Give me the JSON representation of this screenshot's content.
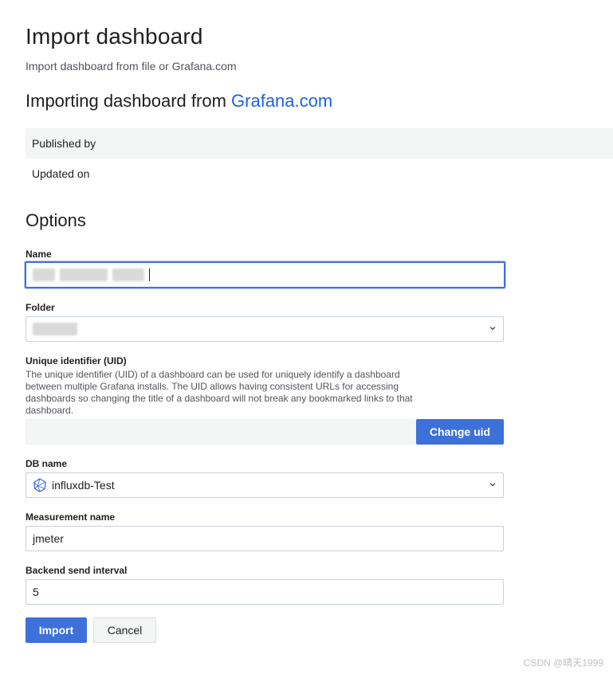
{
  "header": {
    "title": "Import dashboard",
    "subtitle": "Import dashboard from file or Grafana.com"
  },
  "importing": {
    "prefix": "Importing dashboard from ",
    "link": "Grafana.com"
  },
  "info": {
    "published_by": "Published by",
    "updated_on": "Updated on"
  },
  "options": {
    "title": "Options",
    "name_label": "Name",
    "folder_label": "Folder",
    "uid_label": "Unique identifier (UID)",
    "uid_description": "The unique identifier (UID) of a dashboard can be used for uniquely identify a dashboard between multiple Grafana installs. The UID allows having consistent URLs for accessing dashboards so changing the title of a dashboard will not break any bookmarked links to that dashboard.",
    "change_uid_label": "Change uid",
    "db_label": "DB name",
    "db_value": "influxdb-Test",
    "measurement_label": "Measurement name",
    "measurement_value": "jmeter",
    "interval_label": "Backend send interval",
    "interval_value": "5"
  },
  "actions": {
    "import_label": "Import",
    "cancel_label": "Cancel"
  },
  "watermark": "CSDN @晴天1999",
  "colors": {
    "primary": "#3d71d9",
    "link": "#1f62e0"
  }
}
